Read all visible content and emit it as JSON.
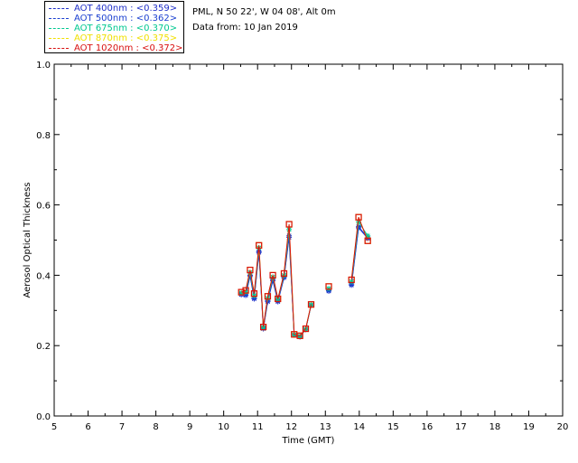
{
  "header": {
    "site": "PML, N 50 22', W 04 08', Alt 0m",
    "date": "Data from: 10 Jan 2019"
  },
  "legend": [
    {
      "label": "AOT  400nm : <0.359>",
      "color": "#2030c8"
    },
    {
      "label": "AOT  500nm : <0.362>",
      "color": "#1a3fd0"
    },
    {
      "label": "AOT  675nm : <0.370>",
      "color": "#00c890"
    },
    {
      "label": "AOT  870nm : <0.375>",
      "color": "#f0e000"
    },
    {
      "label": "AOT 1020nm : <0.372>",
      "color": "#d81010"
    }
  ],
  "chart_data": {
    "type": "line",
    "xlabel": "Time (GMT)",
    "ylabel": "Aerosol Optical Thickness",
    "xlim": [
      5,
      20
    ],
    "ylim": [
      0.0,
      1.0
    ],
    "xticks": [
      "5",
      "6",
      "7",
      "8",
      "9",
      "10",
      "11",
      "12",
      "13",
      "14",
      "15",
      "16",
      "17",
      "18",
      "19",
      "20"
    ],
    "yticks": [
      "0.0",
      "0.2",
      "0.4",
      "0.6",
      "0.8",
      "1.0"
    ],
    "series": [
      {
        "name": "AOT  400nm : <0.359>",
        "color": "#2030c8",
        "marker": "star",
        "x": [
          10.52,
          10.65,
          10.78,
          10.9,
          11.04,
          11.17,
          11.3,
          11.45,
          11.6,
          11.78,
          11.93,
          12.08,
          12.25,
          12.42,
          12.58,
          13.1,
          13.77,
          13.98,
          14.25
        ],
        "y": [
          0.345,
          0.343,
          0.398,
          0.333,
          0.465,
          0.248,
          0.325,
          0.385,
          0.325,
          0.393,
          0.508,
          0.23,
          0.225,
          0.246,
          0.315,
          0.355,
          0.372,
          0.535,
          0.505
        ]
      },
      {
        "name": "AOT  500nm : <0.362>",
        "color": "#1a3fd0",
        "marker": "star",
        "x": [
          10.52,
          10.65,
          10.78,
          10.9,
          11.04,
          11.17,
          11.3,
          11.45,
          11.6,
          11.78,
          11.93,
          12.08,
          12.25,
          12.42,
          12.58,
          13.1,
          13.77,
          13.98,
          14.25
        ],
        "y": [
          0.347,
          0.345,
          0.4,
          0.336,
          0.468,
          0.25,
          0.328,
          0.388,
          0.328,
          0.396,
          0.512,
          0.23,
          0.226,
          0.246,
          0.316,
          0.357,
          0.375,
          0.538,
          0.507
        ]
      },
      {
        "name": "AOT  675nm : <0.370>",
        "color": "#00c890",
        "marker": "star",
        "x": [
          10.52,
          10.65,
          10.78,
          10.9,
          11.04,
          11.17,
          11.3,
          11.45,
          11.6,
          11.78,
          11.93,
          12.08,
          12.25,
          12.42,
          12.58,
          13.1,
          13.77,
          13.98,
          14.25
        ],
        "y": [
          0.35,
          0.352,
          0.408,
          0.342,
          0.478,
          0.252,
          0.335,
          0.395,
          0.332,
          0.4,
          0.53,
          0.231,
          0.227,
          0.247,
          0.316,
          0.362,
          0.382,
          0.552,
          0.512
        ]
      },
      {
        "name": "AOT  870nm : <0.375>",
        "color": "#f0e000",
        "marker": "square",
        "x": [
          10.52,
          10.65,
          10.78,
          10.9,
          11.04,
          11.17,
          11.3,
          11.45,
          11.6,
          11.78,
          11.93,
          12.08,
          12.25,
          12.42,
          12.58,
          13.1,
          13.77,
          13.98,
          14.25
        ],
        "y": [
          0.352,
          0.357,
          0.415,
          0.348,
          0.485,
          0.253,
          0.34,
          0.4,
          0.333,
          0.405,
          0.545,
          0.232,
          0.228,
          0.248,
          0.317,
          0.368,
          0.387,
          0.565,
          0.498
        ]
      },
      {
        "name": "AOT 1020nm : <0.372>",
        "color": "#d81010",
        "marker": "square",
        "x": [
          10.52,
          10.65,
          10.78,
          10.9,
          11.04,
          11.17,
          11.3,
          11.45,
          11.6,
          11.78,
          11.93,
          12.08,
          12.25,
          12.42,
          12.58,
          13.1,
          13.77,
          13.98,
          14.25
        ],
        "y": [
          0.352,
          0.357,
          0.415,
          0.348,
          0.485,
          0.253,
          0.34,
          0.4,
          0.333,
          0.405,
          0.545,
          0.232,
          0.228,
          0.248,
          0.317,
          0.368,
          0.387,
          0.565,
          0.498
        ]
      }
    ]
  }
}
